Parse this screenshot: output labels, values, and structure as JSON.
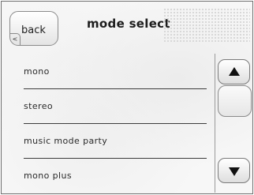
{
  "header": {
    "back_label": "back",
    "back_glyph": "<",
    "title": "mode select"
  },
  "list": {
    "items": [
      {
        "label": "mono"
      },
      {
        "label": "stereo"
      },
      {
        "label": "music mode party"
      },
      {
        "label": "mono plus"
      }
    ]
  },
  "scrollbar": {
    "up_icon": "triangle-up-icon",
    "down_icon": "triangle-down-icon"
  },
  "colors": {
    "text": "#2a2a2a",
    "divider": "#3c3c3c",
    "border": "#6e6e6e"
  }
}
